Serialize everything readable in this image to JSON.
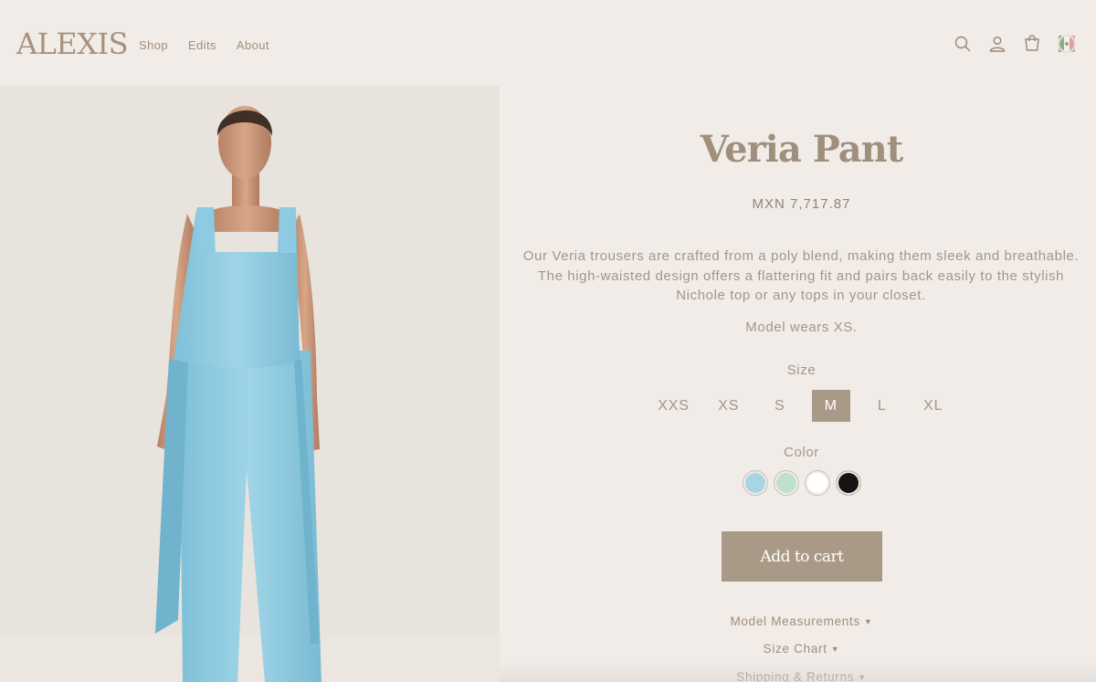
{
  "brand": {
    "name": "ALEXIS"
  },
  "nav": {
    "items": [
      "Shop",
      "Edits",
      "About"
    ]
  },
  "header_icons": [
    "search-icon",
    "account-icon",
    "cart-icon",
    "country-flag-icon"
  ],
  "product": {
    "title": "Veria Pant",
    "price": "MXN 7,717.87",
    "description": "Our Veria trousers are crafted from a poly blend, making them sleek and breathable. The high-waisted design offers a flattering fit and pairs back easily to the stylish Nichole top or any tops in your closet.",
    "model_note": "Model wears XS.",
    "size_label": "Size",
    "sizes": [
      "XXS",
      "XS",
      "S",
      "M",
      "L",
      "XL"
    ],
    "selected_size": "M",
    "color_label": "Color",
    "colors": [
      "#a9d4e4",
      "#bfe0cc",
      "#ffffff",
      "#151313"
    ],
    "add_to_cart": "Add to cart",
    "accordions": [
      "Model Measurements",
      "Size Chart",
      "Shipping & Returns"
    ]
  },
  "theme": {
    "accent": "#a89a86",
    "background": "#f2ece8",
    "text": "#a0958a"
  }
}
